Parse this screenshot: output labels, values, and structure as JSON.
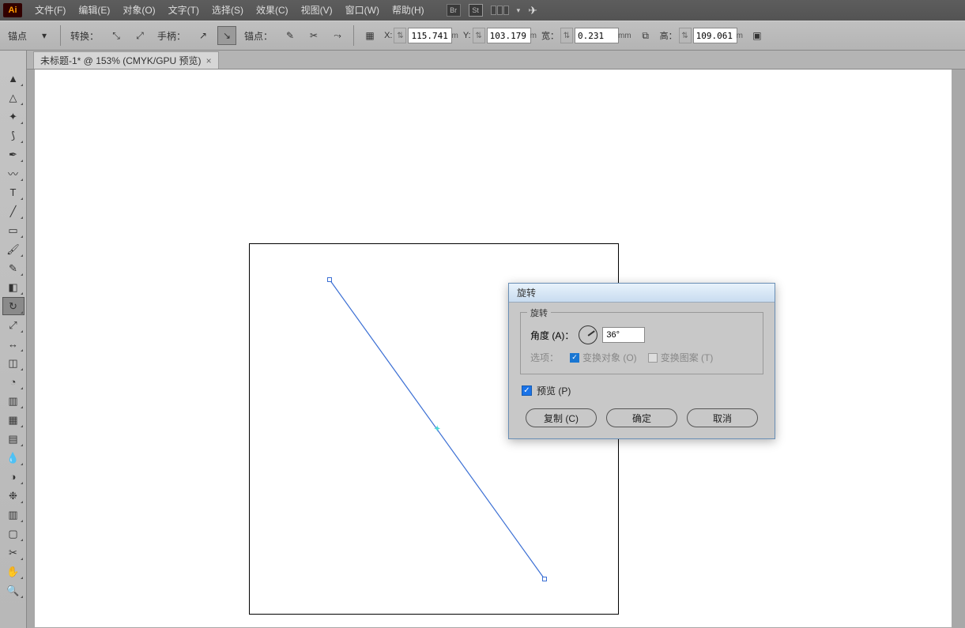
{
  "app": {
    "logo": "Ai"
  },
  "menu": {
    "items": [
      "文件(F)",
      "编辑(E)",
      "对象(O)",
      "文字(T)",
      "选择(S)",
      "效果(C)",
      "视图(V)",
      "窗口(W)",
      "帮助(H)"
    ],
    "extras": {
      "br": "Br",
      "st": "St"
    }
  },
  "control": {
    "anchor_label": "锚点",
    "convert_label": "转换：",
    "handle_label": "手柄：",
    "anchor2_label": "锚点：",
    "x": {
      "label": "X:",
      "value": "115.741",
      "unit": "m"
    },
    "y": {
      "label": "Y:",
      "value": "103.179",
      "unit": "m"
    },
    "w": {
      "label": "宽：",
      "value": "0.231",
      "unit": "mm"
    },
    "h": {
      "label": "高：",
      "value": "109.061",
      "unit": "m"
    }
  },
  "tab": {
    "title": "未标题-1* @ 153% (CMYK/GPU 预览)"
  },
  "tools": [
    {
      "name": "selection",
      "glyph": "▲"
    },
    {
      "name": "direct-select",
      "glyph": "△"
    },
    {
      "name": "magic-wand",
      "glyph": "✦"
    },
    {
      "name": "lasso",
      "glyph": "⟆"
    },
    {
      "name": "pen",
      "glyph": "✒"
    },
    {
      "name": "curvature",
      "glyph": "〰"
    },
    {
      "name": "type",
      "glyph": "T"
    },
    {
      "name": "line",
      "glyph": "╱"
    },
    {
      "name": "rectangle",
      "glyph": "▭"
    },
    {
      "name": "brush",
      "glyph": "🖌"
    },
    {
      "name": "pencil",
      "glyph": "✎"
    },
    {
      "name": "eraser",
      "glyph": "◧"
    },
    {
      "name": "rotate",
      "glyph": "↻",
      "selected": true
    },
    {
      "name": "scale",
      "glyph": "⤢"
    },
    {
      "name": "width",
      "glyph": "↔"
    },
    {
      "name": "free-transform",
      "glyph": "◫"
    },
    {
      "name": "shape-builder",
      "glyph": "◔"
    },
    {
      "name": "perspective",
      "glyph": "▥"
    },
    {
      "name": "mesh",
      "glyph": "▦"
    },
    {
      "name": "gradient",
      "glyph": "▤"
    },
    {
      "name": "eyedropper",
      "glyph": "💧"
    },
    {
      "name": "blend",
      "glyph": "◑"
    },
    {
      "name": "symbol-sprayer",
      "glyph": "❉"
    },
    {
      "name": "graph",
      "glyph": "▥"
    },
    {
      "name": "artboard",
      "glyph": "▢"
    },
    {
      "name": "slice",
      "glyph": "✂"
    },
    {
      "name": "hand",
      "glyph": "✋"
    },
    {
      "name": "zoom",
      "glyph": "🔍"
    }
  ],
  "dialog": {
    "title": "旋转",
    "fieldset": "旋转",
    "angle_label": "角度 (A)：",
    "angle_value": "36°",
    "options_label": "选项：",
    "transform_objects": "变换对象 (O)",
    "transform_patterns": "变换图案 (T)",
    "preview": "预览 (P)",
    "buttons": {
      "copy": "复制 (C)",
      "ok": "确定",
      "cancel": "取消"
    }
  }
}
